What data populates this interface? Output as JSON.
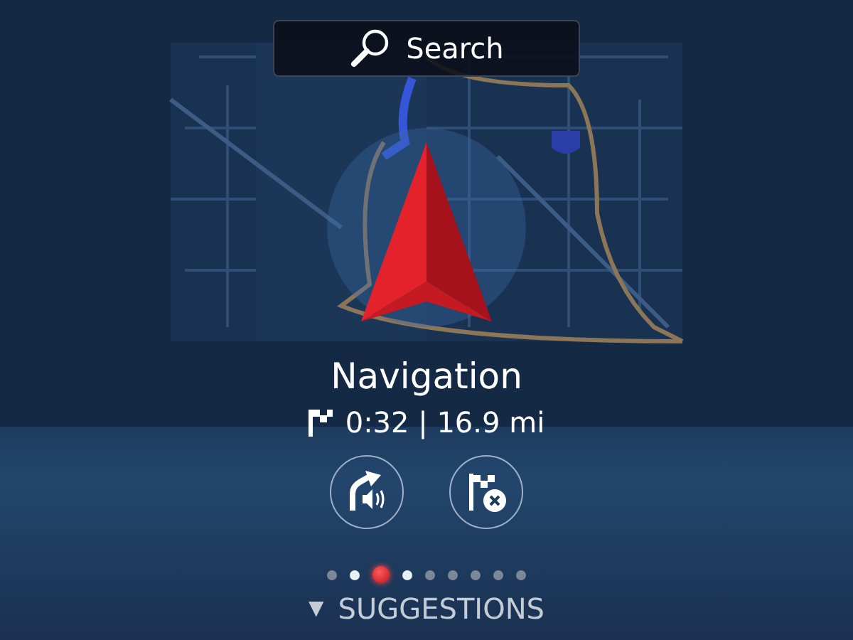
{
  "search": {
    "label": "Search"
  },
  "title": "Navigation",
  "summary": "0:32 | 16.9 mi",
  "actions": [
    {
      "kind": "voice"
    },
    {
      "kind": "cancel"
    }
  ],
  "pages": [
    {
      "selected": false
    },
    {
      "selected": false
    },
    {
      "selected": true
    },
    {
      "selected": false
    },
    {
      "selected": false
    },
    {
      "selected": false
    },
    {
      "selected": false
    },
    {
      "selected": false
    },
    {
      "selected": false
    }
  ],
  "suggestions": {
    "arrow": "▼",
    "label": "SUGGESTIONS"
  }
}
